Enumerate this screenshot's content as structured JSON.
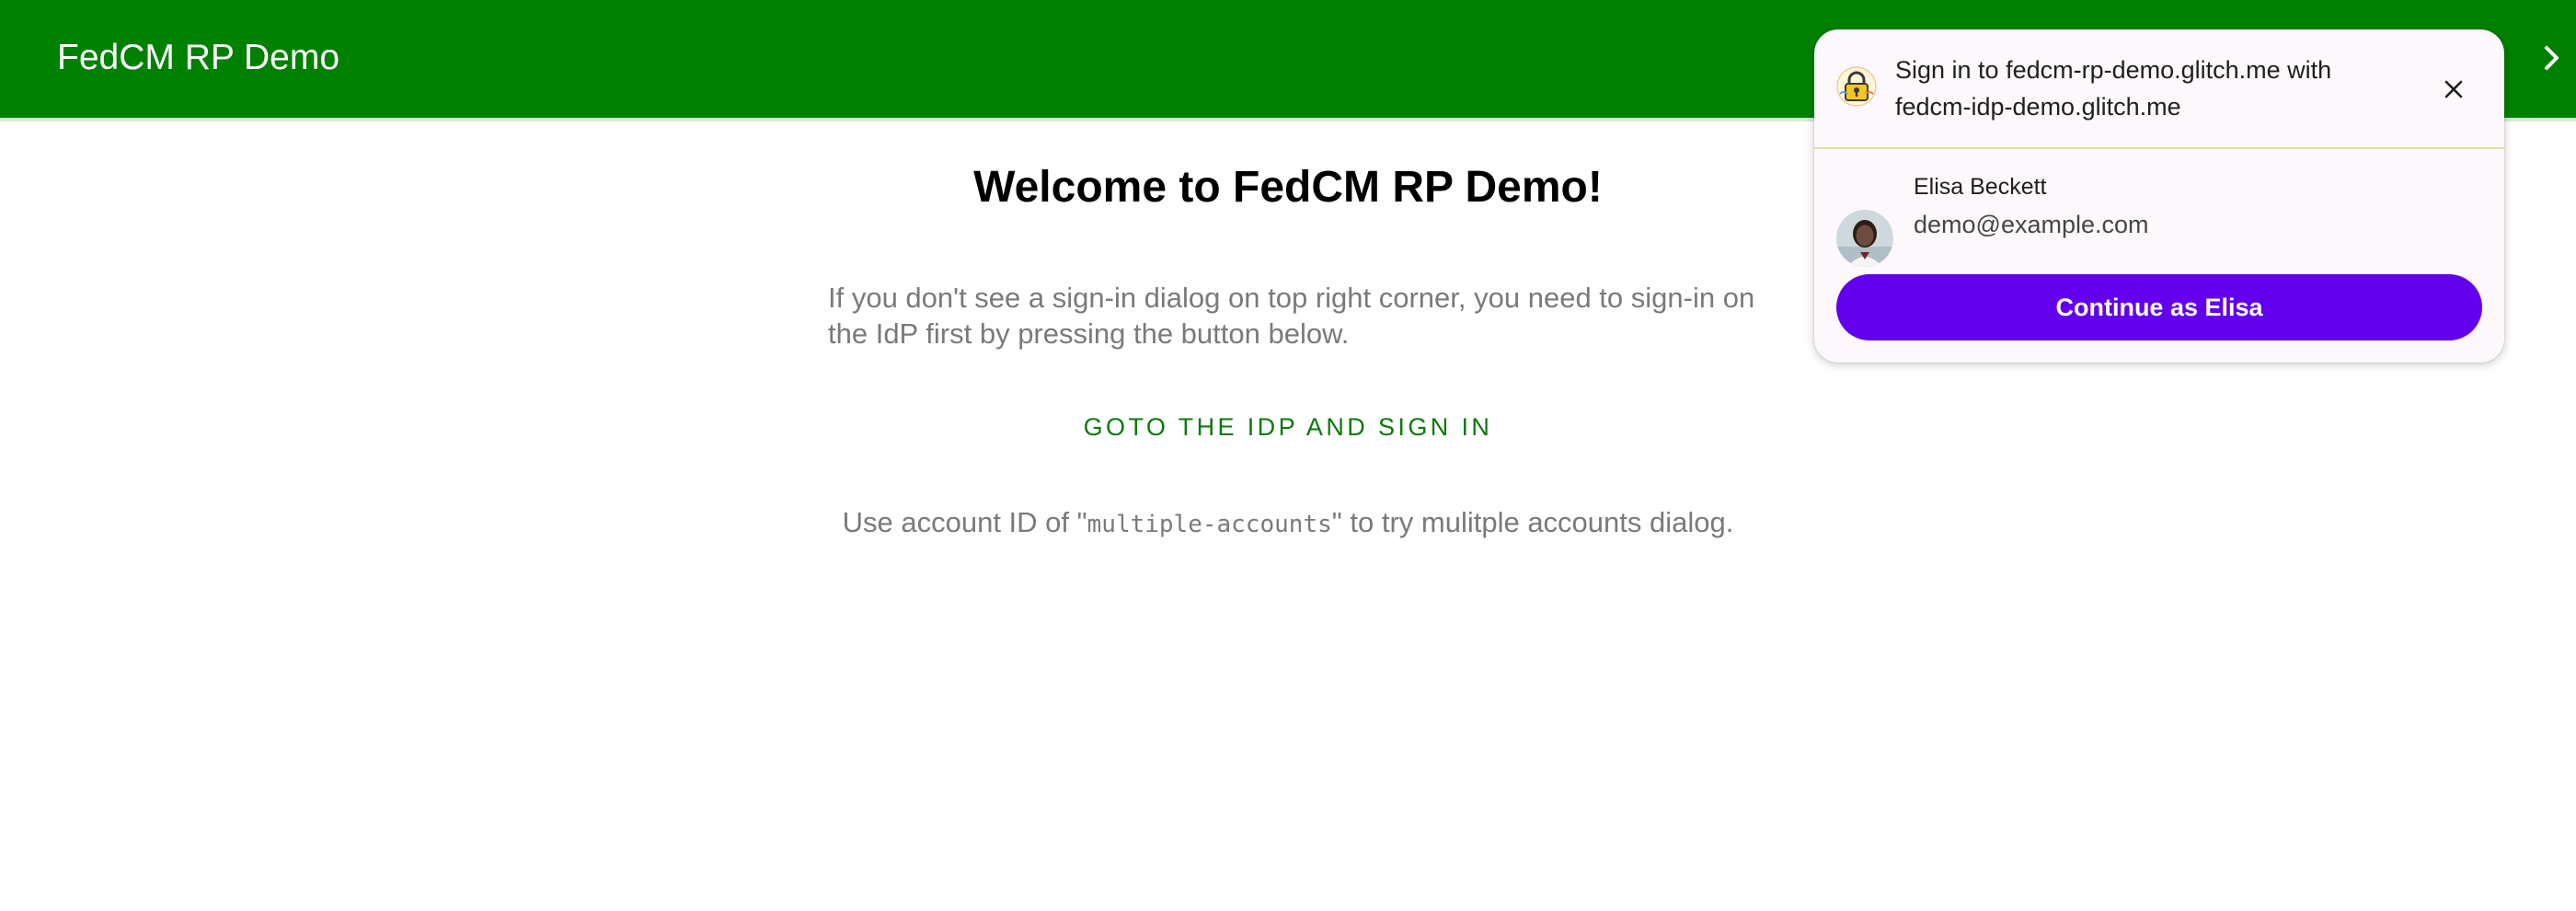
{
  "appbar": {
    "title": "FedCM RP Demo",
    "background_color": "#008000"
  },
  "main": {
    "title": "Welcome to FedCM RP Demo!",
    "intro": "If you don't see a sign-in dialog on top right corner, you need to sign-in on the IdP first by pressing the button below.",
    "idp_link_label": "GOTO THE IDP AND SIGN IN",
    "hint_prefix": "Use account ID of \"",
    "hint_code": "multiple-accounts",
    "hint_suffix": "\" to try mulitple accounts dialog."
  },
  "dialog": {
    "idp_icon": "lock-icon",
    "title": "Sign in to fedcm-rp-demo.glitch.me with fedcm-idp-demo.glitch.me",
    "close_icon": "close-icon",
    "account": {
      "name": "Elisa Beckett",
      "email": "demo@example.com",
      "avatar_icon": "avatar-icon"
    },
    "continue_label": "Continue as Elisa",
    "continue_color": "#6200ee"
  }
}
